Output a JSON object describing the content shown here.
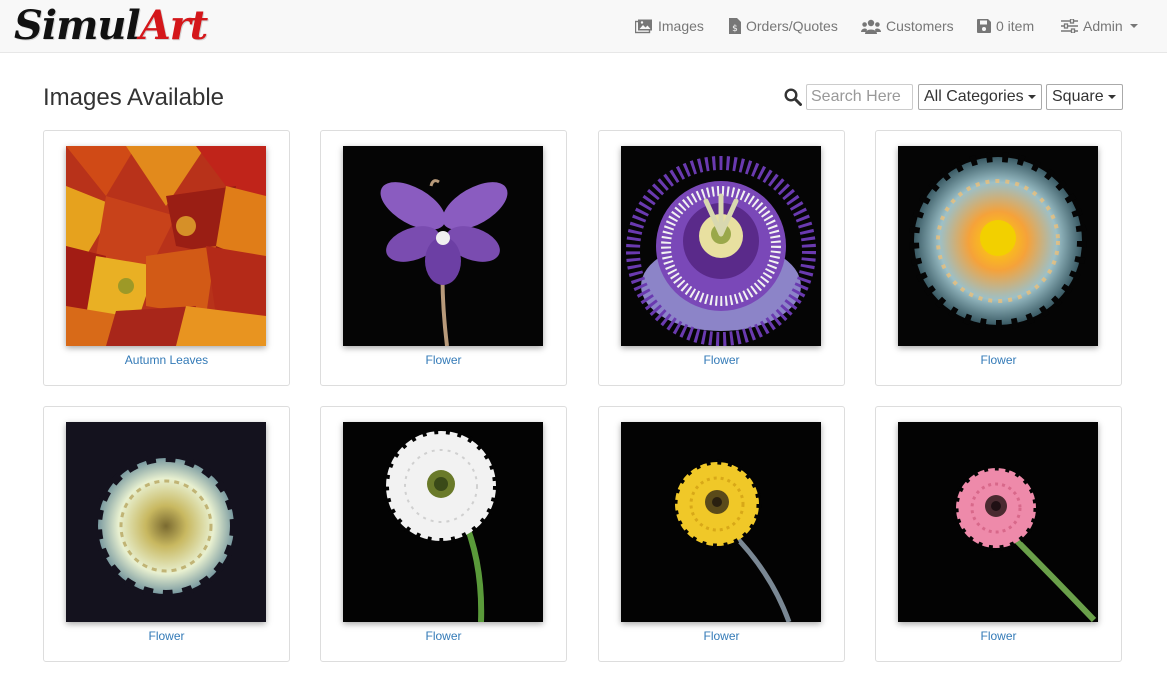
{
  "brand": {
    "part1": "Simul",
    "part2": "Art"
  },
  "nav": {
    "images": "Images",
    "orders": "Orders/Quotes",
    "customers": "Customers",
    "cart": "0 item",
    "admin": "Admin"
  },
  "page": {
    "title": "Images Available"
  },
  "search": {
    "placeholder": "Search Here",
    "value": ""
  },
  "filters": {
    "category": "All Categories",
    "shape": "Square"
  },
  "images": [
    {
      "caption": "Autumn Leaves"
    },
    {
      "caption": "Flower"
    },
    {
      "caption": "Flower"
    },
    {
      "caption": "Flower"
    },
    {
      "caption": "Flower"
    },
    {
      "caption": "Flower"
    },
    {
      "caption": "Flower"
    },
    {
      "caption": "Flower"
    }
  ],
  "colors": {
    "link": "#337ab7",
    "brand_red": "#d4171b",
    "nav_text": "#777777"
  }
}
